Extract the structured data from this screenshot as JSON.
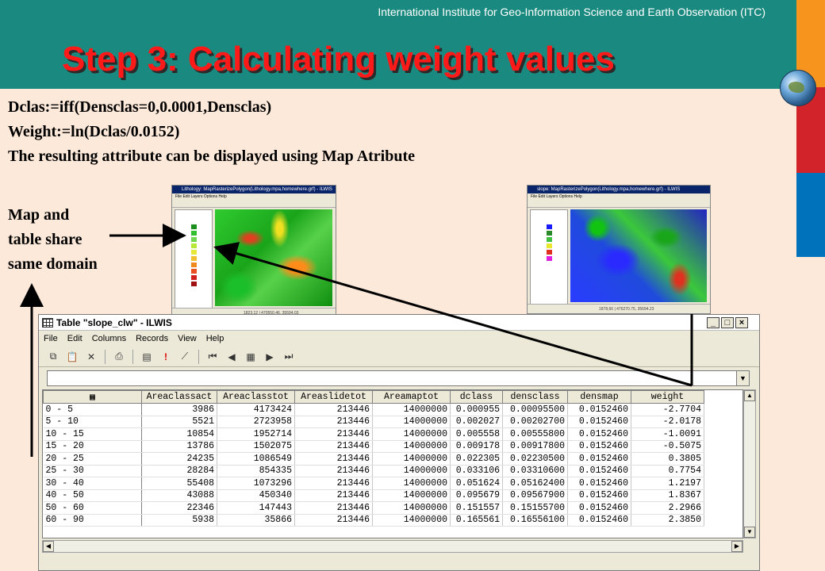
{
  "header": {
    "institute": "International Institute for Geo-Information Science and Earth Observation (ITC)",
    "title": "Step 3: Calculating weight values"
  },
  "body": {
    "line1": "Dclas:=iff(Densclas=0,0.0001,Densclas)",
    "line2": "Weight:=ln(Dclas/0.0152)",
    "line3": "The resulting attribute can be displayed using Map Atribute",
    "note_line1": "Map and",
    "note_line2": "table share",
    "note_line3": "same domain"
  },
  "thumbnails": {
    "left_title": "Lithology: MapRasterizePolygon(Lithology.mpa,homewhere.grf) - ILWIS",
    "left_status": "1823,12  |  470550.46, 35594.03",
    "right_title": "slope: MapRasterizePolygon(Lithology.mpa,homewhere.grf) - ILWIS",
    "right_status": "1878,66  |  476270.75, 35694.23"
  },
  "table_window": {
    "title": "Table \"slope_clw\" - ILWIS",
    "menu": [
      "File",
      "Edit",
      "Columns",
      "Records",
      "View",
      "Help"
    ],
    "columns": [
      "Areaclassact",
      "Areaclasstot",
      "Areaslidetot",
      "Areamaptot",
      "dclass",
      "densclass",
      "densmap",
      "weight"
    ],
    "rows": [
      {
        "key": "0 - 5",
        "cells": [
          "3986",
          "4173424",
          "213446",
          "14000000",
          "0.000955",
          "0.00095500",
          "0.0152460",
          "-2.7704"
        ]
      },
      {
        "key": "5 - 10",
        "cells": [
          "5521",
          "2723958",
          "213446",
          "14000000",
          "0.002027",
          "0.00202700",
          "0.0152460",
          "-2.0178"
        ]
      },
      {
        "key": "10 - 15",
        "cells": [
          "10854",
          "1952714",
          "213446",
          "14000000",
          "0.005558",
          "0.00555800",
          "0.0152460",
          "-1.0091"
        ]
      },
      {
        "key": "15 - 20",
        "cells": [
          "13786",
          "1502075",
          "213446",
          "14000000",
          "0.009178",
          "0.00917800",
          "0.0152460",
          "-0.5075"
        ]
      },
      {
        "key": "20 - 25",
        "cells": [
          "24235",
          "1086549",
          "213446",
          "14000000",
          "0.022305",
          "0.02230500",
          "0.0152460",
          "0.3805"
        ]
      },
      {
        "key": "25 - 30",
        "cells": [
          "28284",
          "854335",
          "213446",
          "14000000",
          "0.033106",
          "0.03310600",
          "0.0152460",
          "0.7754"
        ]
      },
      {
        "key": "30 - 40",
        "cells": [
          "55408",
          "1073296",
          "213446",
          "14000000",
          "0.051624",
          "0.05162400",
          "0.0152460",
          "1.2197"
        ]
      },
      {
        "key": "40 - 50",
        "cells": [
          "43088",
          "450340",
          "213446",
          "14000000",
          "0.095679",
          "0.09567900",
          "0.0152460",
          "1.8367"
        ]
      },
      {
        "key": "50 - 60",
        "cells": [
          "22346",
          "147443",
          "213446",
          "14000000",
          "0.151557",
          "0.15155700",
          "0.0152460",
          "2.2966"
        ]
      },
      {
        "key": "60 - 90",
        "cells": [
          "5938",
          "35866",
          "213446",
          "14000000",
          "0.165561",
          "0.16556100",
          "0.0152460",
          "2.3850"
        ]
      }
    ]
  },
  "colors": {
    "header_teal": "#1a8a80",
    "title_red": "#ff1a1a",
    "background": "#fde9d9",
    "stripe_orange": "#f7941d",
    "stripe_red": "#d2232a",
    "stripe_blue": "#0072bc"
  }
}
